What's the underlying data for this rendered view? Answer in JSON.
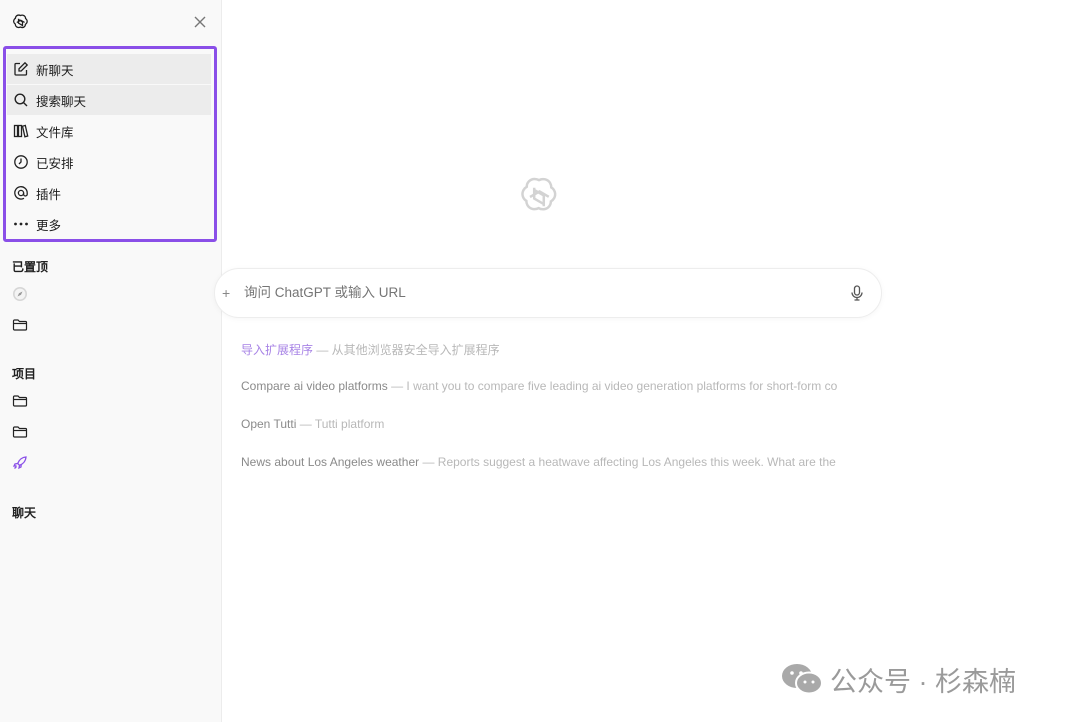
{
  "sidebar": {
    "menu": [
      {
        "label": "新聊天",
        "icon": "edit-icon"
      },
      {
        "label": "搜索聊天",
        "icon": "search-icon"
      },
      {
        "label": "文件库",
        "icon": "library-icon"
      },
      {
        "label": "已安排",
        "icon": "clock-icon"
      },
      {
        "label": "插件",
        "icon": "at-icon"
      },
      {
        "label": "更多",
        "icon": "more-icon"
      }
    ],
    "pinned_title": "已置顶",
    "projects_title": "项目",
    "chats_title": "聊天"
  },
  "main": {
    "input_placeholder": "询问 ChatGPT 或输入 URL",
    "input_plus": "+",
    "suggestions": [
      {
        "title": "导入扩展程序",
        "desc": " — 从其他浏览器安全导入扩展程序"
      },
      {
        "title": "Compare ai video platforms",
        "desc": " — I want you to compare five leading ai video generation platforms for short-form co"
      },
      {
        "title": "Open Tutti",
        "desc": " — Tutti platform"
      },
      {
        "title": "News about Los Angeles weather",
        "desc": " — Reports suggest a heatwave affecting Los Angeles this week. What are the"
      }
    ]
  },
  "watermark": {
    "text": "公众号 · 杉森楠"
  },
  "colors": {
    "accent": "#8a4fe8",
    "sidebar_bg": "#f9f9f9"
  }
}
